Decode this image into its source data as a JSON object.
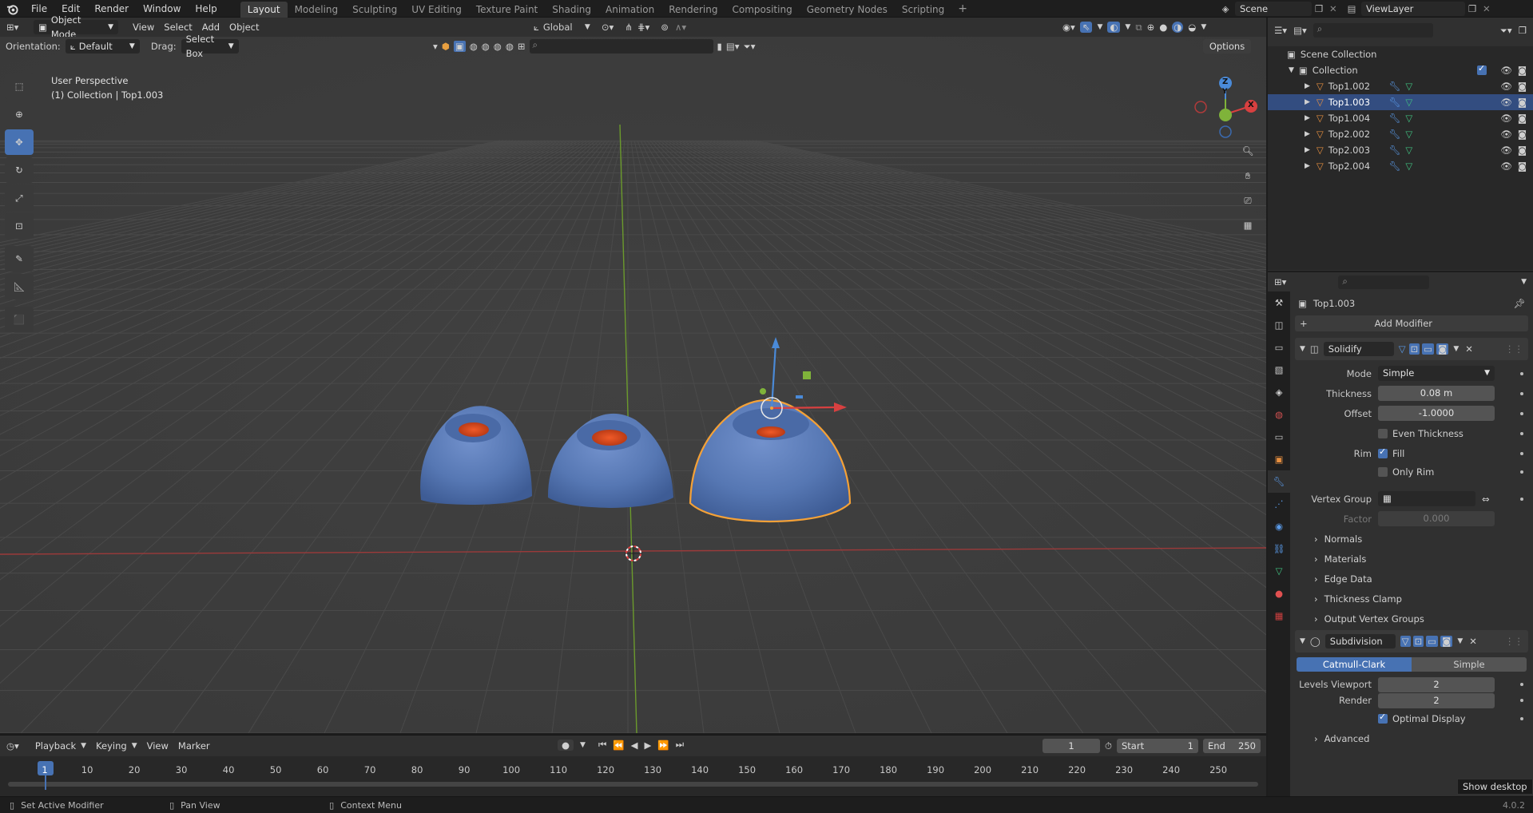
{
  "topbar": {
    "menus": [
      "File",
      "Edit",
      "Render",
      "Window",
      "Help"
    ],
    "workspaces": [
      "Layout",
      "Modeling",
      "Sculpting",
      "UV Editing",
      "Texture Paint",
      "Shading",
      "Animation",
      "Rendering",
      "Compositing",
      "Geometry Nodes",
      "Scripting"
    ],
    "active_workspace": "Layout",
    "scene": "Scene",
    "view_layer": "ViewLayer"
  },
  "viewport_header": {
    "mode": "Object Mode",
    "menus": [
      "View",
      "Select",
      "Add",
      "Object"
    ],
    "transform_orientation": "Global",
    "orientation_label": "Orientation:",
    "orientation_value": "Default",
    "drag_label": "Drag:",
    "drag_value": "Select Box",
    "options": "Options"
  },
  "viewport": {
    "view_name": "User Perspective",
    "view_info": "(1) Collection | Top1.003",
    "gizmo_axes": [
      "Z",
      "Y",
      "X"
    ]
  },
  "outliner": {
    "root": "Scene Collection",
    "collection": "Collection",
    "objects": [
      {
        "name": "Top1.002",
        "selected": false
      },
      {
        "name": "Top1.003",
        "selected": true
      },
      {
        "name": "Top1.004",
        "selected": false
      },
      {
        "name": "Top2.002",
        "selected": false
      },
      {
        "name": "Top2.003",
        "selected": false
      },
      {
        "name": "Top2.004",
        "selected": false
      }
    ]
  },
  "properties": {
    "object_name": "Top1.003",
    "add_modifier": "Add Modifier",
    "solidify": {
      "name": "Solidify",
      "mode_label": "Mode",
      "mode_value": "Simple",
      "thickness_label": "Thickness",
      "thickness_value": "0.08 m",
      "offset_label": "Offset",
      "offset_value": "-1.0000",
      "even_thickness": "Even Thickness",
      "rim_label": "Rim",
      "rim_fill": "Fill",
      "only_rim": "Only Rim",
      "vertex_group_label": "Vertex Group",
      "factor_label": "Factor",
      "factor_value": "0.000",
      "subsections": [
        "Normals",
        "Materials",
        "Edge Data",
        "Thickness Clamp",
        "Output Vertex Groups"
      ]
    },
    "subdivision": {
      "name": "Subdivision",
      "method_active": "Catmull-Clark",
      "method_other": "Simple",
      "levels_viewport_label": "Levels Viewport",
      "levels_viewport_value": "2",
      "render_label": "Render",
      "render_value": "2",
      "optimal_display": "Optimal Display",
      "advanced": "Advanced"
    }
  },
  "timeline": {
    "menus": [
      "Playback",
      "Keying",
      "View",
      "Marker"
    ],
    "current_frame": "1",
    "start_label": "Start",
    "start_value": "1",
    "end_label": "End",
    "end_value": "250",
    "ticks": [
      "1",
      "10",
      "20",
      "30",
      "40",
      "50",
      "60",
      "70",
      "80",
      "90",
      "100",
      "110",
      "120",
      "130",
      "140",
      "150",
      "160",
      "170",
      "180",
      "190",
      "200",
      "210",
      "220",
      "230",
      "240",
      "250"
    ]
  },
  "statusbar": {
    "left": "Set Active Modifier",
    "middle": "Pan View",
    "right": "Context Menu",
    "version": "4.0.2"
  },
  "tooltip": "Show desktop",
  "colors": {
    "accent": "#4772b3",
    "selection_outline": "#f4a137",
    "mesh": "#5a7bb8",
    "mesh_inner": "#d8461e",
    "axis_x": "#c23a3a",
    "axis_y": "#6aa52a"
  }
}
